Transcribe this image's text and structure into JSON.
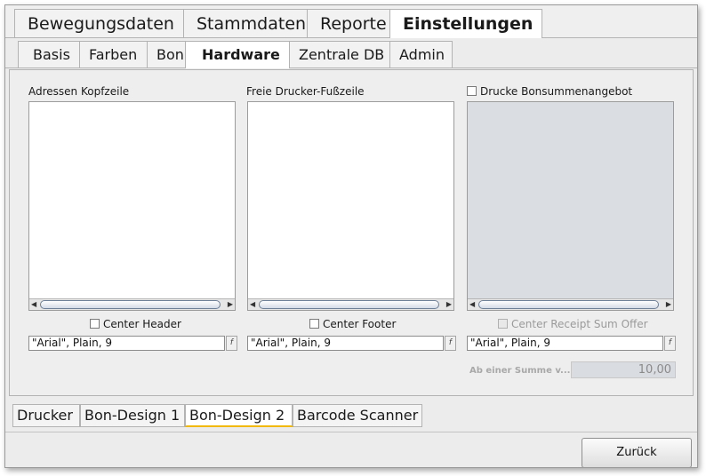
{
  "top_tabs": [
    {
      "label": "Bewegungsdaten"
    },
    {
      "label": "Stammdaten"
    },
    {
      "label": "Reporte"
    },
    {
      "label": "Einstellungen"
    }
  ],
  "sub_tabs": [
    {
      "label": "Basis"
    },
    {
      "label": "Farben"
    },
    {
      "label": "Bon"
    },
    {
      "label": "Hardware"
    },
    {
      "label": "Zentrale DB"
    },
    {
      "label": "Admin"
    }
  ],
  "col1": {
    "label": "Adressen Kopfzeile",
    "checkbox_label": "Center Header",
    "font_value": "\"Arial\", Plain, 9",
    "font_button": "f"
  },
  "col2": {
    "label": "Freie Drucker-Fußzeile",
    "checkbox_label": "Center Footer",
    "font_value": "\"Arial\", Plain, 9",
    "font_button": "f"
  },
  "col3": {
    "checkbox_top_label": "Drucke Bonsummenangebot",
    "checkbox_label": "Center Receipt Sum Offer",
    "font_value": "\"Arial\", Plain, 9",
    "font_button": "f",
    "sum_label": "Ab einer Summe v...",
    "sum_value": "10,00"
  },
  "bottom_tabs": [
    {
      "label": "Drucker"
    },
    {
      "label": "Bon-Design 1"
    },
    {
      "label": "Bon-Design 2"
    },
    {
      "label": "Barcode Scanner"
    }
  ],
  "footer": {
    "back_label": "Zurück"
  },
  "colors": {
    "active_tab_underline": "#f2b800",
    "disabled_area": "#dadde2"
  }
}
